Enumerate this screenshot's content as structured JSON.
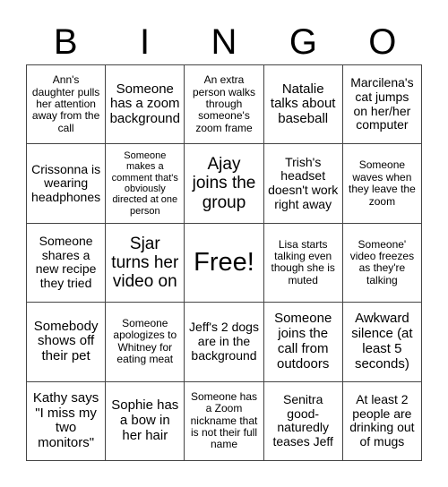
{
  "header": {
    "letters": [
      "B",
      "I",
      "N",
      "G",
      "O"
    ]
  },
  "board": {
    "cells": [
      [
        "Ann's daughter pulls her attention away from the call",
        "Someone has a zoom background",
        "An extra person walks through someone's zoom frame",
        "Natalie talks about baseball",
        "Marcilena's cat jumps on her/her computer"
      ],
      [
        "Crissonna is wearing headphones",
        "Someone makes a comment that's obviously directed at one person",
        "Ajay joins the group",
        "Trish's headset doesn't work right away",
        "Someone waves when they leave the zoom"
      ],
      [
        "Someone shares a new recipe they tried",
        "Sjar turns her video on",
        "Free!",
        "Lisa starts talking even though she is muted",
        "Someone' video freezes as they're talking"
      ],
      [
        "Somebody shows off their pet",
        "Someone apologizes to Whitney for eating meat",
        "Jeff's 2 dogs are in the background",
        "Someone joins the call from outdoors",
        "Awkward silence (at least 5 seconds)"
      ],
      [
        "Kathy says \"I miss my two monitors\"",
        "Sophie has a bow in her hair",
        "Someone has a Zoom nickname that is not their full name",
        "Senitra good-naturedly teases Jeff",
        "At least 2 people are drinking out of mugs"
      ]
    ]
  }
}
